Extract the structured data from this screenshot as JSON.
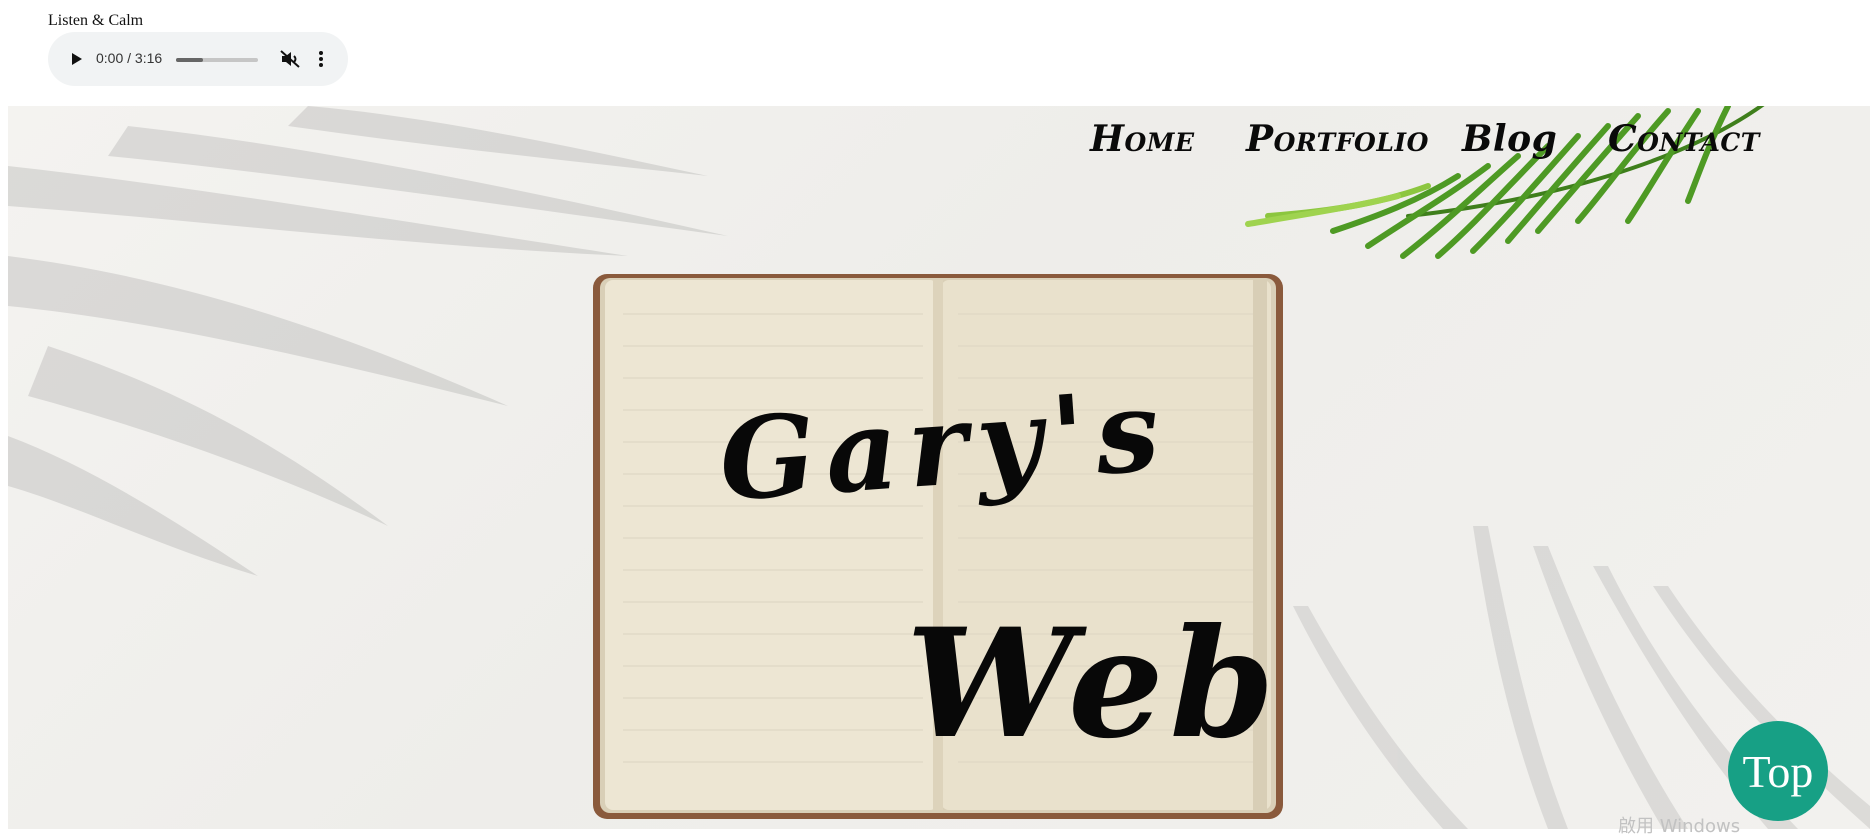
{
  "audio": {
    "caption": "Listen & Calm",
    "time_display": "0:00 / 3:16",
    "progress_fraction": 0.33
  },
  "nav": {
    "home": "Home",
    "portfolio": "Portfolio",
    "blog": "Blog",
    "contact": "Contact"
  },
  "hero": {
    "title_line1": "Gary's",
    "title_line2": "Web"
  },
  "top_button": {
    "label": "Top"
  },
  "watermark": {
    "text": "啟用 Windows"
  },
  "colors": {
    "accent": "#17a085",
    "page_bg": "#ffffff",
    "hero_bg": "#f1f0ed",
    "notebook_paper": "#ece4cf",
    "notebook_cover": "#8a5a3c",
    "leaf_green": "#5aa82a"
  },
  "icons": {
    "play": "play-icon",
    "mute": "volume-muted-icon",
    "more": "more-vertical-icon"
  }
}
